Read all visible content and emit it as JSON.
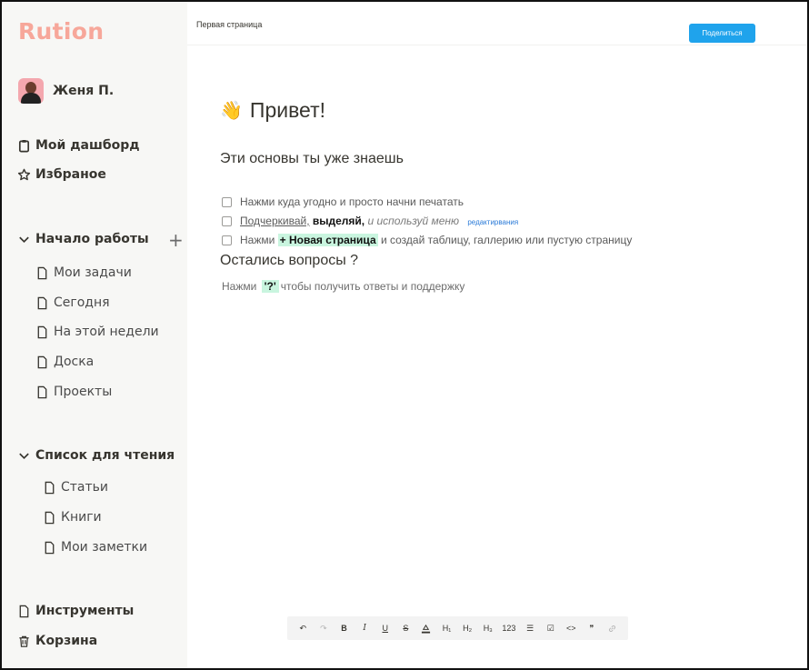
{
  "app": {
    "logo": "Rution"
  },
  "user": {
    "name": "Женя П."
  },
  "sidebar": {
    "top_items": [
      {
        "label": "Мой дашборд",
        "icon": "clipboard-icon"
      },
      {
        "label": "Избраное",
        "icon": "star-icon"
      }
    ],
    "sections": [
      {
        "title": "Начало работы",
        "items": [
          "Мои задачи",
          "Сегодня",
          "На этой недели",
          "Доска",
          "Проекты"
        ]
      },
      {
        "title": "Список для чтения",
        "items": [
          "Статьи",
          "Книги",
          "Мои заметки"
        ]
      }
    ],
    "bottom_items": [
      {
        "label": "Инструменты",
        "icon": "page-icon"
      },
      {
        "label": "Корзина",
        "icon": "trash-icon"
      }
    ]
  },
  "header": {
    "breadcrumb": "Первая страница",
    "share_label": "Поделиться"
  },
  "content": {
    "title_emoji": "👋",
    "title": "Привет!",
    "basics_heading": "Эти основы ты уже знаешь",
    "todos": [
      {
        "text": "Нажми куда угодно и  просто начни печатать"
      },
      {
        "underlined": "Подчеркивай,",
        "bold": "выделяй,",
        "italic": "и используй меню",
        "small": "редактирвания"
      },
      {
        "before": "Нажми",
        "highlight": "+ Новая страница",
        "after": "и создай таблицу, галлерию или пустую страницу"
      }
    ],
    "questions_heading": "Остались вопросы ?",
    "help": {
      "before": "Нажми",
      "key": "'?'",
      "after": "чтобы получить ответы и поддержку"
    }
  },
  "toolbar": {
    "undo": "↶",
    "redo": "↷",
    "bold": "B",
    "italic": "I",
    "underline": "U",
    "strike": "S",
    "h1": "H₁",
    "h2": "H₂",
    "h3": "H₃",
    "numbered": "123",
    "bullets": "☰",
    "todo": "☑",
    "code": "<>",
    "quote": "❞",
    "link": "🔗"
  },
  "colors": {
    "logo": "#f7a79a",
    "accent": "#1fa3ec",
    "highlight": "#c9f5df",
    "sidebar_bg": "#f7f7f5"
  }
}
